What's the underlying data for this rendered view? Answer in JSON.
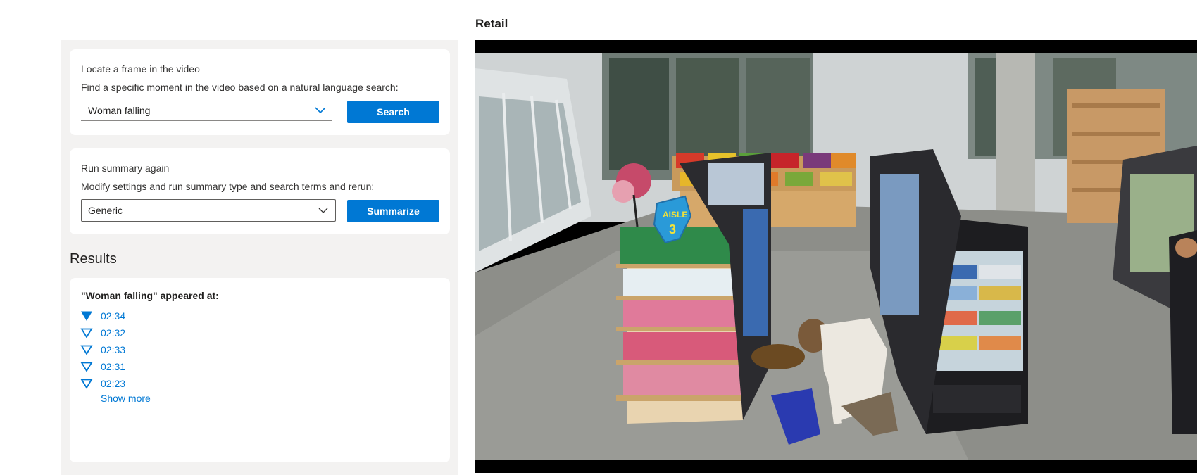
{
  "locate": {
    "title": "Locate a frame in the video",
    "description": "Find a specific moment in the video based on a natural language search:",
    "query_value": "Woman falling",
    "search_label": "Search"
  },
  "summary": {
    "title": "Run summary again",
    "description": "Modify settings and run summary type and search terms and rerun:",
    "type_value": "Generic",
    "summarize_label": "Summarize"
  },
  "results": {
    "heading": "Results",
    "header": "\"Woman falling\" appeared at:",
    "items": [
      {
        "time": "02:34",
        "selected": true
      },
      {
        "time": "02:32",
        "selected": false
      },
      {
        "time": "02:33",
        "selected": false
      },
      {
        "time": "02:31",
        "selected": false
      },
      {
        "time": "02:23",
        "selected": false
      }
    ],
    "show_more_label": "Show more"
  },
  "video": {
    "title": "Retail",
    "aisle_sign_label": "AISLE",
    "aisle_sign_number": "3"
  },
  "colors": {
    "accent": "#0078d4",
    "panel_bg": "#f3f2f1",
    "card_bg": "#ffffff"
  }
}
